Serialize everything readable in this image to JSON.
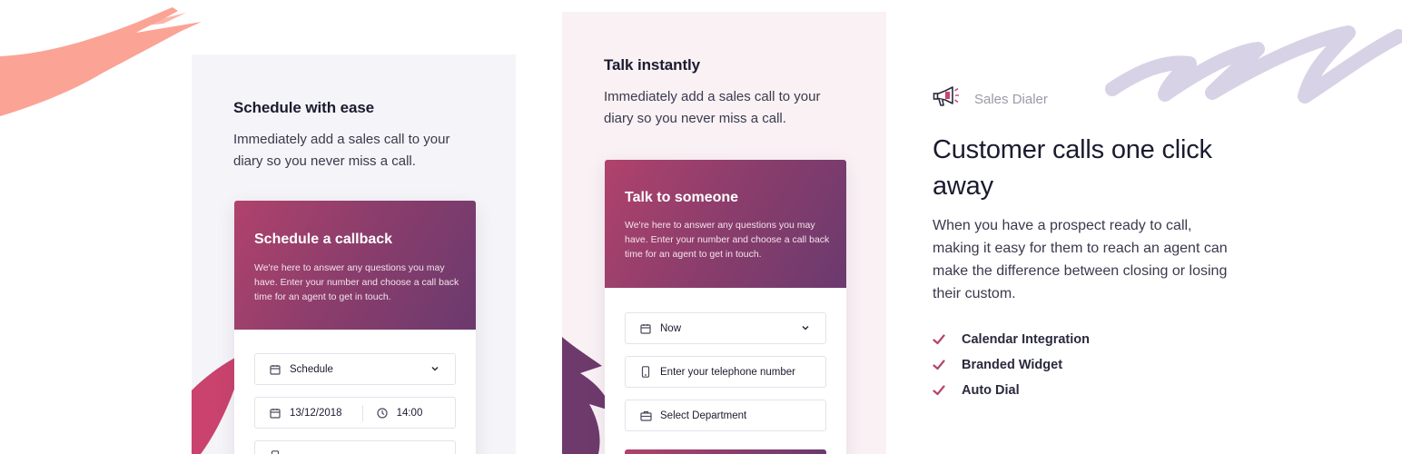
{
  "colors": {
    "accent": "#b0426c",
    "accent_dark": "#6b3a6e",
    "check": "#b5446f",
    "panel_left_bg": "#f5f4f8",
    "panel_mid_bg": "#f9f1f4"
  },
  "panel_left": {
    "title": "Schedule with ease",
    "description": "Immediately add a sales call to your diary so you never miss a call.",
    "card": {
      "title": "Schedule a callback",
      "text": "We're here to answer any questions you may have. Enter your number and choose a call back time for an agent to get in touch.",
      "schedule_select": {
        "value": "Schedule",
        "icon": "calendar-icon"
      },
      "date_field": {
        "value": "13/12/2018",
        "icon": "calendar-icon"
      },
      "time_field": {
        "value": "14:00",
        "icon": "clock-icon"
      }
    }
  },
  "panel_mid": {
    "title": "Talk instantly",
    "description": "Immediately add a sales call to your diary so you never miss a call.",
    "card": {
      "title": "Talk to someone",
      "text": "We're here to answer any questions you may have. Enter your number and choose a call back time for an agent to get in touch.",
      "when_select": {
        "value": "Now",
        "icon": "calendar-icon"
      },
      "phone_field": {
        "placeholder": "Enter your telephone number",
        "icon": "phone-icon"
      },
      "department_select": {
        "value": "Select Department",
        "icon": "briefcase-icon"
      }
    }
  },
  "right": {
    "brand": {
      "name": "Sales Dialer",
      "icon": "megaphone-icon"
    },
    "headline": "Customer calls one click away",
    "body": "When you have a prospect ready to call, making it easy for them to reach an agent can make the difference between closing or losing their custom.",
    "features": [
      {
        "label": "Calendar Integration",
        "icon": "check-icon"
      },
      {
        "label": "Branded Widget",
        "icon": "check-icon"
      },
      {
        "label": "Auto Dial",
        "icon": "check-icon"
      }
    ]
  }
}
